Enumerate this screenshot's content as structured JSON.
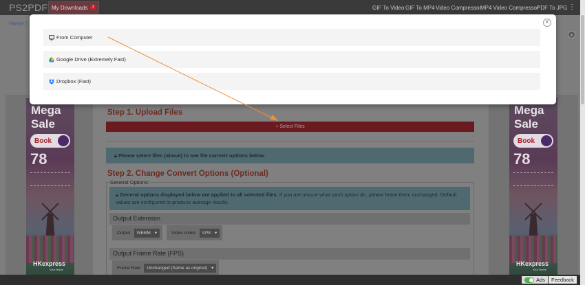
{
  "nav": {
    "logo": "PS2PDF",
    "my_downloads": "My Downloads",
    "badge": "7",
    "links": [
      "GIF To Video",
      "GIF To MP4",
      "Video Compressor",
      "MP4 Video Compressor",
      "PDF To JPG"
    ],
    "menu_icon": "⋮"
  },
  "breadcrumb": {
    "home": "Home",
    "sep": "/"
  },
  "ads": {
    "close": "x",
    "mega": "Mega",
    "sale": "Sale",
    "book": "Book",
    "price": "78",
    "brand": "HKexpress",
    "brand_tag": "Your Home"
  },
  "modal": {
    "close": "X",
    "options": [
      {
        "label": "From Computer",
        "icon": "monitor-icon"
      },
      {
        "label": "Google Drive (Extremely Fast)",
        "icon": "google-drive-icon"
      },
      {
        "label": "Dropbox (Fast)",
        "icon": "dropbox-icon"
      }
    ]
  },
  "step1": {
    "title": "Step 1. Upload Files",
    "button": "+ Select Files"
  },
  "info1": {
    "text": "Please select files (above) to see file convert options below."
  },
  "step2": {
    "title": "Step 2. Change Convert Options (Optional)",
    "general_legend": "General Options:",
    "info_bold": "General options displayed below are applied to all selected files.",
    "info_rest": " If you are unsure what each option do, please leave them unchanged. Default values are configured to produce average results.",
    "output_extension": {
      "title": "Output Extension",
      "output_label": "Output",
      "output_value": "WEBM",
      "codec_label": "Video codec",
      "codec_value": "VP8"
    },
    "frame_rate": {
      "title": "Output Frame Rate (FPS)",
      "label": "Frame Rate",
      "value": "Unchanged (Same as original)"
    }
  },
  "bottom": {
    "ads": "Ads",
    "feedback": "Feedback"
  },
  "colors": {
    "accent": "#c1272d",
    "overlay": "#7d7d7d",
    "arrow": "#f0913a",
    "toggle": "#4caf50"
  }
}
